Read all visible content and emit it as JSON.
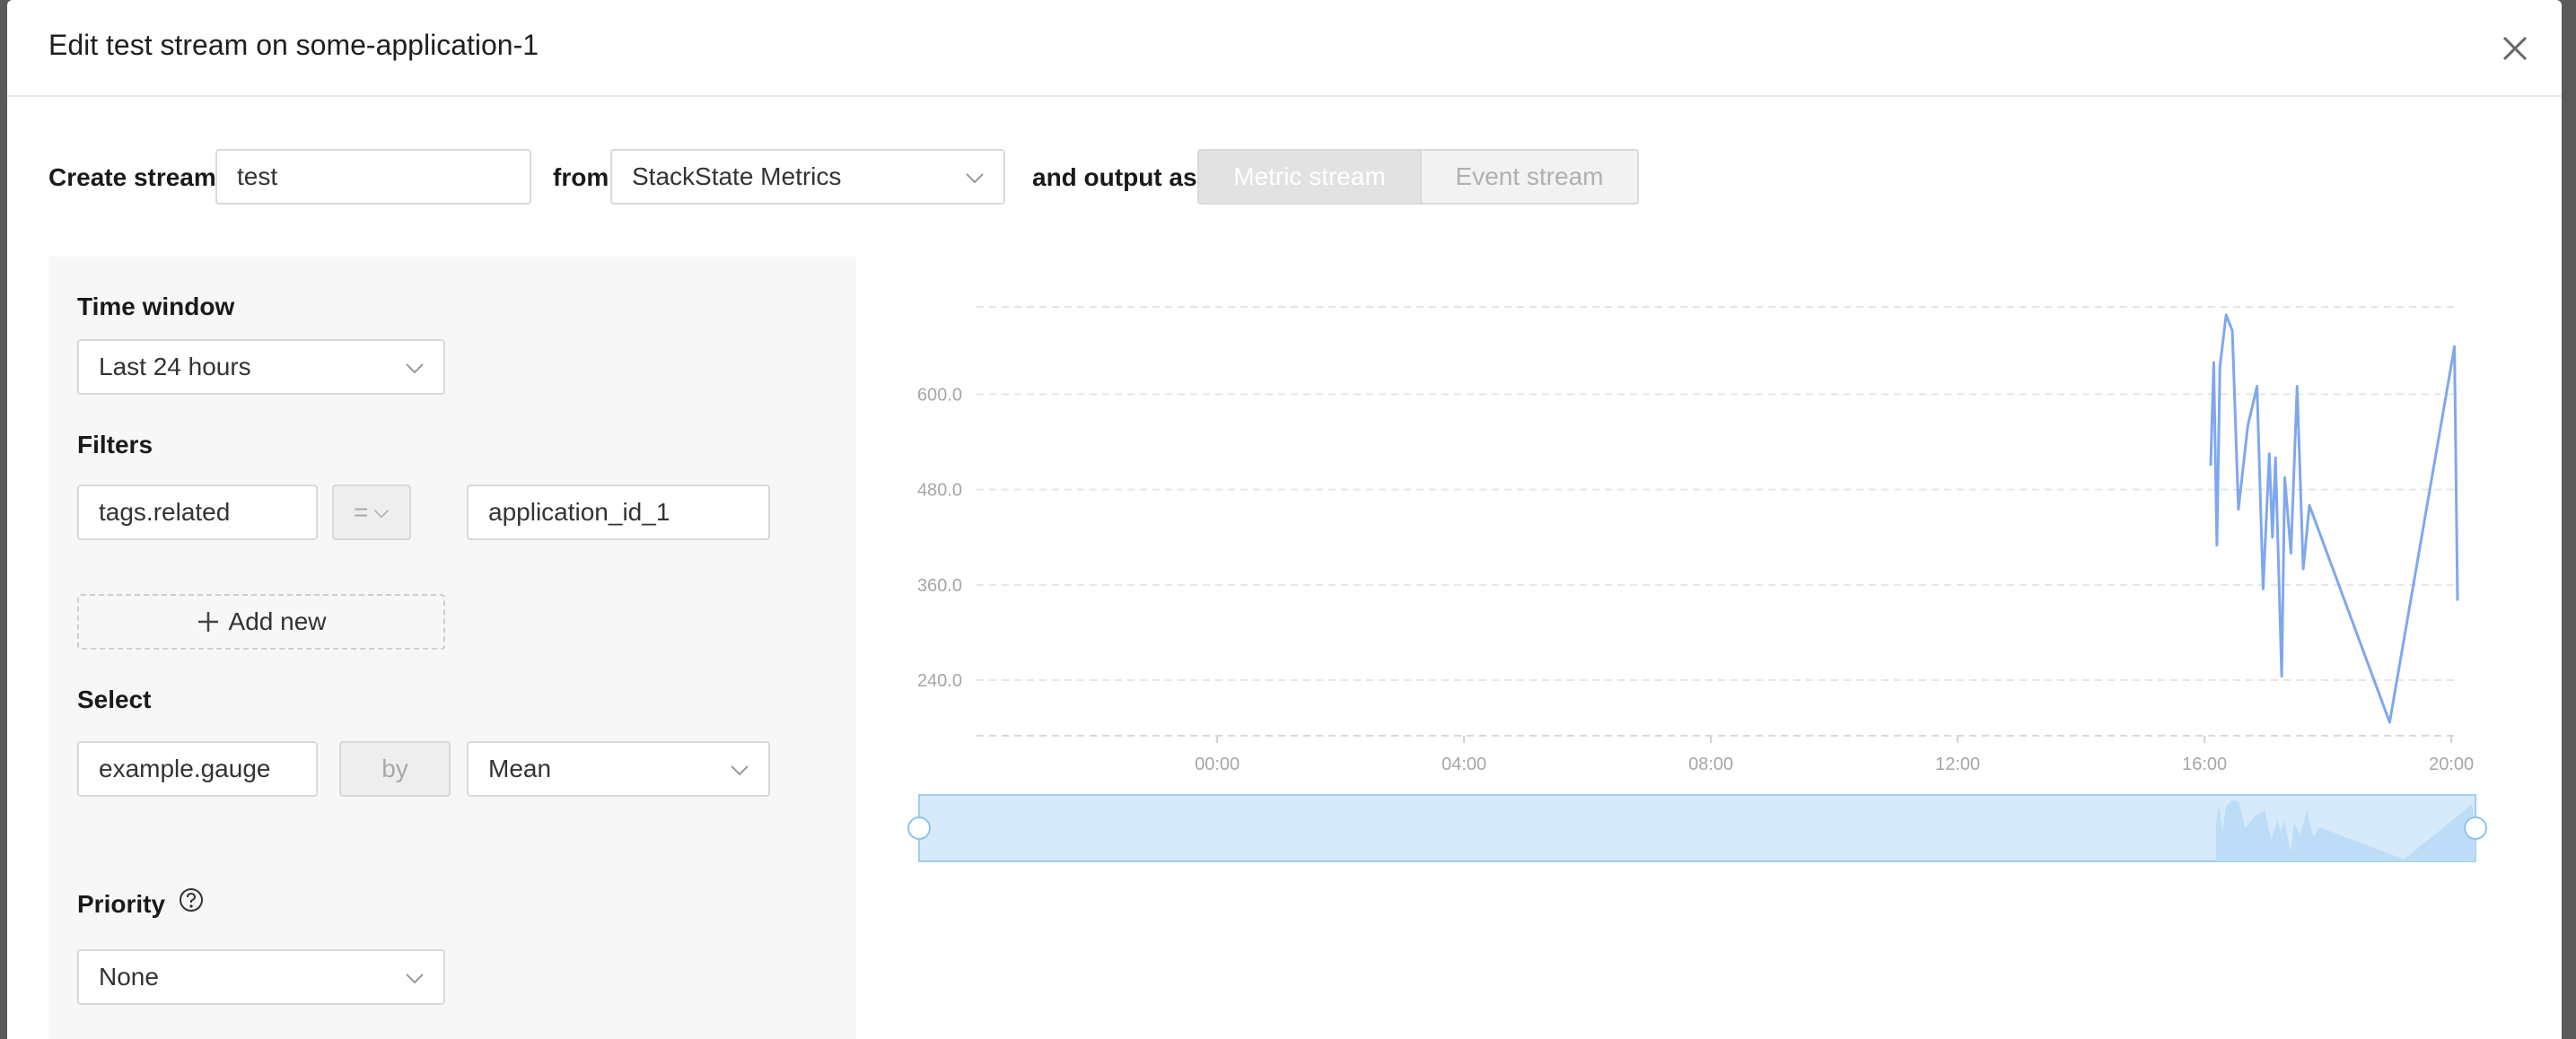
{
  "modal": {
    "title": "Edit test stream on some-application-1"
  },
  "stream": {
    "create_label": "Create stream",
    "name_value": "test",
    "from_label": "from",
    "source_value": "StackState Metrics",
    "output_label": "and output as",
    "output_options": [
      "Metric stream",
      "Event stream"
    ],
    "output_selected": "Metric stream"
  },
  "panel": {
    "time_window_label": "Time window",
    "time_window_value": "Last 24 hours",
    "filters_label": "Filters",
    "filter": {
      "key": "tags.related",
      "operator": "=",
      "value": "application_id_1"
    },
    "add_new_label": "Add new",
    "select_label": "Select",
    "select_metric": "example.gauge",
    "by_label": "by",
    "aggregation": "Mean",
    "priority_label": "Priority",
    "priority_value": "None"
  },
  "chart_data": {
    "type": "line",
    "y_ticks": [
      "240.0",
      "360.0",
      "480.0",
      "600.0"
    ],
    "x_ticks": [
      "00:00",
      "04:00",
      "08:00",
      "12:00",
      "16:00",
      "20:00"
    ],
    "ylim": [
      170,
      710
    ],
    "xlim_hours": [
      -3.9,
      20.1
    ],
    "grid": true,
    "line_color": "#7fa7ef",
    "points": [
      [
        16.1,
        510
      ],
      [
        16.15,
        640
      ],
      [
        16.2,
        410
      ],
      [
        16.25,
        635
      ],
      [
        16.35,
        700
      ],
      [
        16.45,
        680
      ],
      [
        16.55,
        455
      ],
      [
        16.7,
        560
      ],
      [
        16.85,
        610
      ],
      [
        16.95,
        355
      ],
      [
        17.05,
        525
      ],
      [
        17.1,
        420
      ],
      [
        17.15,
        520
      ],
      [
        17.25,
        245
      ],
      [
        17.3,
        495
      ],
      [
        17.4,
        400
      ],
      [
        17.5,
        610
      ],
      [
        17.6,
        380
      ],
      [
        17.7,
        460
      ],
      [
        19.0,
        187
      ],
      [
        20.05,
        660
      ],
      [
        20.1,
        340
      ]
    ],
    "brush": {
      "fill": "#d6eafb",
      "stroke": "#9fcff3",
      "area_color": "#bddcf7"
    }
  }
}
